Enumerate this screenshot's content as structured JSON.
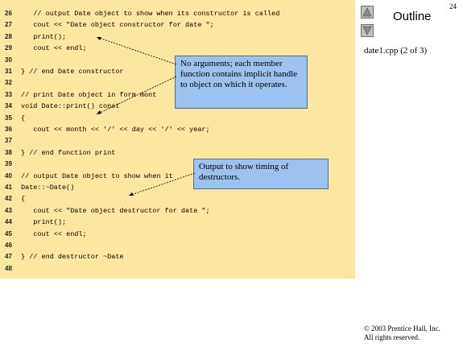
{
  "page": {
    "number": "24"
  },
  "outline": {
    "title": "Outline",
    "file_label": "date1.cpp (2 of 3)",
    "up_button": "up-arrow",
    "down_button": "down-arrow"
  },
  "code_lines": [
    {
      "num": "26",
      "text": "   // output Date object to show when its constructor is called"
    },
    {
      "num": "27",
      "text": "   cout << \"Date object constructor for date \";"
    },
    {
      "num": "28",
      "text": "   print();"
    },
    {
      "num": "29",
      "text": "   cout << endl;"
    },
    {
      "num": "30",
      "text": ""
    },
    {
      "num": "31",
      "text": "} // end Date constructor"
    },
    {
      "num": "32",
      "text": ""
    },
    {
      "num": "33",
      "text": "// print Date object in form mont"
    },
    {
      "num": "34",
      "text": "void Date::print() const"
    },
    {
      "num": "35",
      "text": "{"
    },
    {
      "num": "36",
      "text": "   cout << month << '/' << day << '/' << year;"
    },
    {
      "num": "37",
      "text": ""
    },
    {
      "num": "38",
      "text": "} // end function print"
    },
    {
      "num": "39",
      "text": ""
    },
    {
      "num": "40",
      "text": "// output Date object to show when it"
    },
    {
      "num": "41",
      "text": "Date::~Date()"
    },
    {
      "num": "42",
      "text": "{"
    },
    {
      "num": "43",
      "text": "   cout << \"Date object destructor for date \";"
    },
    {
      "num": "44",
      "text": "   print();"
    },
    {
      "num": "45",
      "text": "   cout << endl;"
    },
    {
      "num": "46",
      "text": ""
    },
    {
      "num": "47",
      "text": "} // end destructor ~Date"
    },
    {
      "num": "48",
      "text": ""
    }
  ],
  "callouts": {
    "first": "No arguments; each member function contains implicit handle to object on which it operates.",
    "second": "Output to show timing of destructors."
  },
  "copyright": {
    "line1": "© 2003 Prentice Hall, Inc.",
    "line2": "All rights reserved."
  }
}
